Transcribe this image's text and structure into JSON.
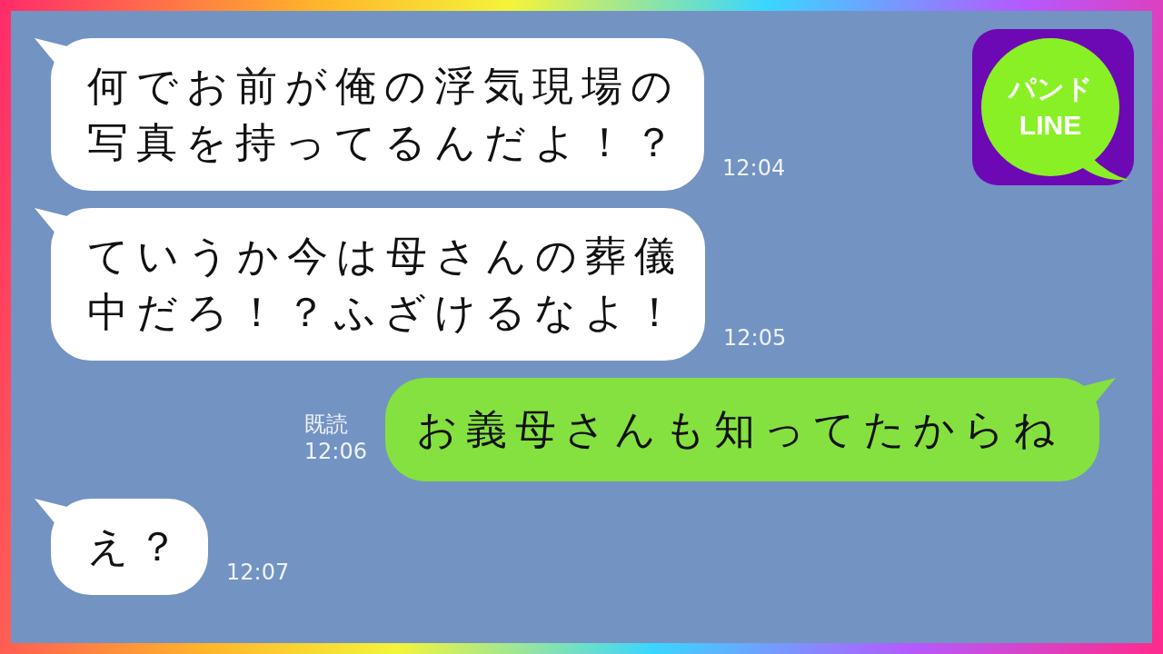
{
  "logo": {
    "lines": [
      "パンド",
      "LINE"
    ]
  },
  "messages": [
    {
      "kind": "received",
      "lines": [
        "何でお前が俺の浮気現場の",
        "写真を持ってるんだよ！？"
      ],
      "time": "12:04"
    },
    {
      "kind": "received",
      "lines": [
        "ていうか今は母さんの葬儀",
        "中だろ！？ふざけるなよ！"
      ],
      "time": "12:05"
    },
    {
      "kind": "sent",
      "lines": [
        "お義母さんも知ってたからね"
      ],
      "read": "既読",
      "time": "12:06"
    },
    {
      "kind": "received",
      "lines": [
        "え？"
      ],
      "time": "12:07"
    }
  ]
}
